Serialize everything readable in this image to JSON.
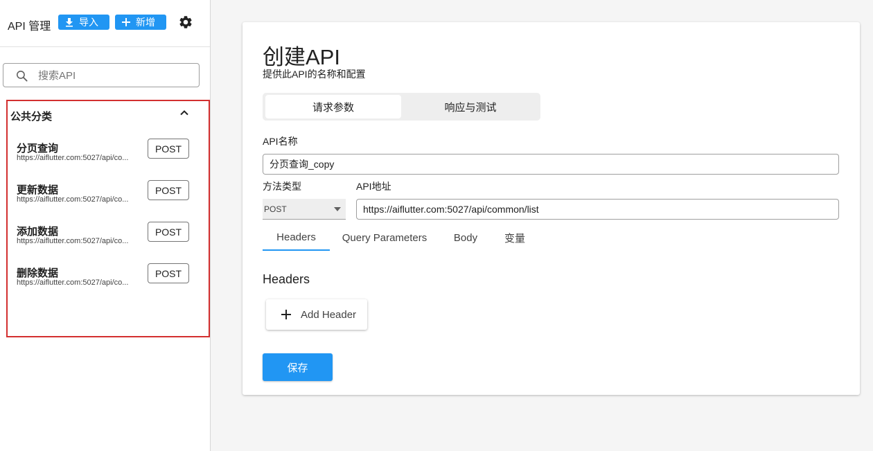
{
  "sidebar": {
    "title": "API 管理",
    "import_label": "导入",
    "add_label": "新增",
    "search_placeholder": "搜索API",
    "category": {
      "title": "公共分类",
      "items": [
        {
          "name": "分页查询",
          "url": "https://aiflutter.com:5027/api/co...",
          "method": "POST"
        },
        {
          "name": "更新数据",
          "url": "https://aiflutter.com:5027/api/co...",
          "method": "POST"
        },
        {
          "name": "添加数据",
          "url": "https://aiflutter.com:5027/api/co...",
          "method": "POST"
        },
        {
          "name": "删除数据",
          "url": "https://aiflutter.com:5027/api/co...",
          "method": "POST"
        }
      ]
    }
  },
  "main": {
    "title": "创建API",
    "subtitle": "提供此API的名称和配置",
    "segments": [
      "请求参数",
      "响应与测试"
    ],
    "api_name_label": "API名称",
    "api_name_value": "分页查询_copy",
    "method_label": "方法类型",
    "method_value": "POST",
    "url_label": "API地址",
    "url_value": "https://aiflutter.com:5027/api/common/list",
    "tabs": [
      "Headers",
      "Query Parameters",
      "Body",
      "变量"
    ],
    "section_title": "Headers",
    "add_header_label": "Add Header",
    "save_label": "保存"
  },
  "colors": {
    "accent": "#2196f3",
    "highlight_border": "#d32f2f"
  },
  "icons": [
    "download-icon",
    "plus-icon",
    "gear-icon",
    "search-icon",
    "chevron-up-icon",
    "dropdown-arrow-icon"
  ]
}
